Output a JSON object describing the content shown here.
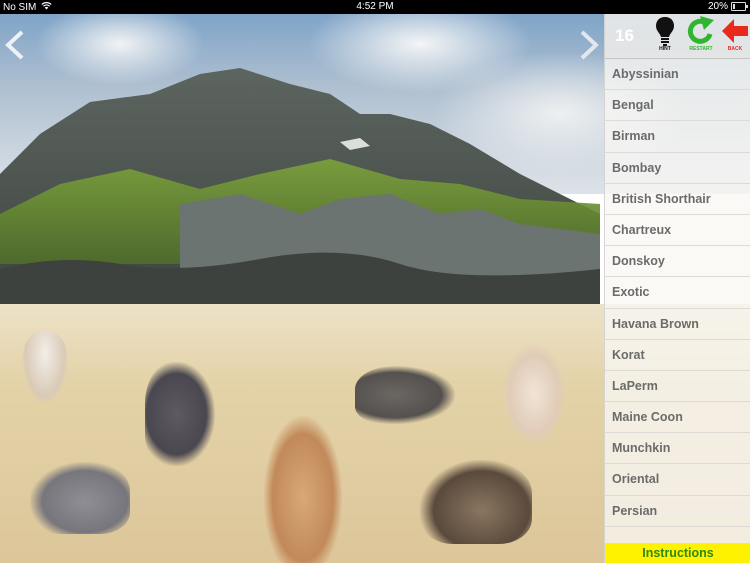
{
  "statusbar": {
    "carrier": "No SIM",
    "time": "4:52 PM",
    "battery_percent": "20%",
    "battery_level": 0.2
  },
  "game": {
    "score": "16",
    "tools": {
      "hint_label": "HINT",
      "restart_label": "RESTART",
      "back_label": "BACK"
    },
    "breeds": [
      "Abyssinian",
      "Bengal",
      "Birman",
      "Bombay",
      "British Shorthair",
      "Chartreux",
      "Donskoy",
      "Exotic",
      "Havana Brown",
      "Korat",
      "LaPerm",
      "Maine Coon",
      "Munchkin",
      "Oriental",
      "Persian"
    ],
    "instructions_label": "Instructions"
  },
  "colors": {
    "hint": "#111111",
    "restart": "#2fb52f",
    "back": "#e8291c",
    "instructions_bg": "#fff200",
    "instructions_text": "#2e8a12"
  }
}
